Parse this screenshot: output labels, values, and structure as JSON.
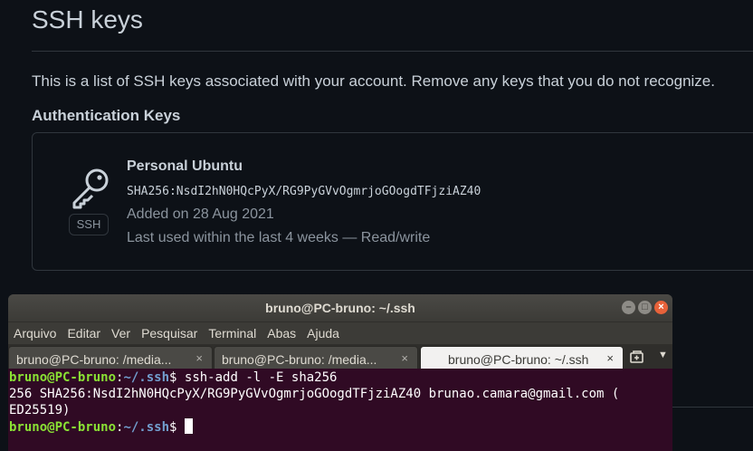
{
  "github": {
    "title": "SSH keys",
    "description": "This is a list of SSH keys associated with your account. Remove any keys that you do not recognize.",
    "section_heading": "Authentication Keys",
    "key": {
      "badge": "SSH",
      "name": "Personal Ubuntu",
      "fingerprint": "SHA256:NsdI2hN0HQcPyX/RG9PyGVvOgmrjoGOogdTFjziAZ40",
      "added": "Added on 28 Aug 2021",
      "last_used": "Last used within the last 4 weeks — Read/write"
    }
  },
  "terminal": {
    "title": "bruno@PC-bruno: ~/.ssh",
    "window_buttons": [
      "–",
      "□",
      "×"
    ],
    "menu": [
      "Arquivo",
      "Editar",
      "Ver",
      "Pesquisar",
      "Terminal",
      "Abas",
      "Ajuda"
    ],
    "tabs": [
      {
        "label": "bruno@PC-bruno: /media...",
        "close": "×"
      },
      {
        "label": "bruno@PC-bruno: /media...",
        "close": "×"
      },
      {
        "label": "bruno@PC-bruno: ~/.ssh",
        "close": "×"
      }
    ],
    "prompt_user": "bruno@PC-bruno",
    "prompt_sep": ":",
    "prompt_path": "~/.ssh",
    "prompt_end": "$ ",
    "command": "ssh-add -l -E sha256",
    "output_line1": "256 SHA256:NsdI2hN0HQcPyX/RG9PyGVvOgmrjoGOogdTFjziAZ40 brunao.camara@gmail.com (",
    "output_line2": "ED25519)",
    "colors": {
      "background": "#300a24",
      "user": "#8ae234",
      "path": "#729fcf"
    }
  }
}
